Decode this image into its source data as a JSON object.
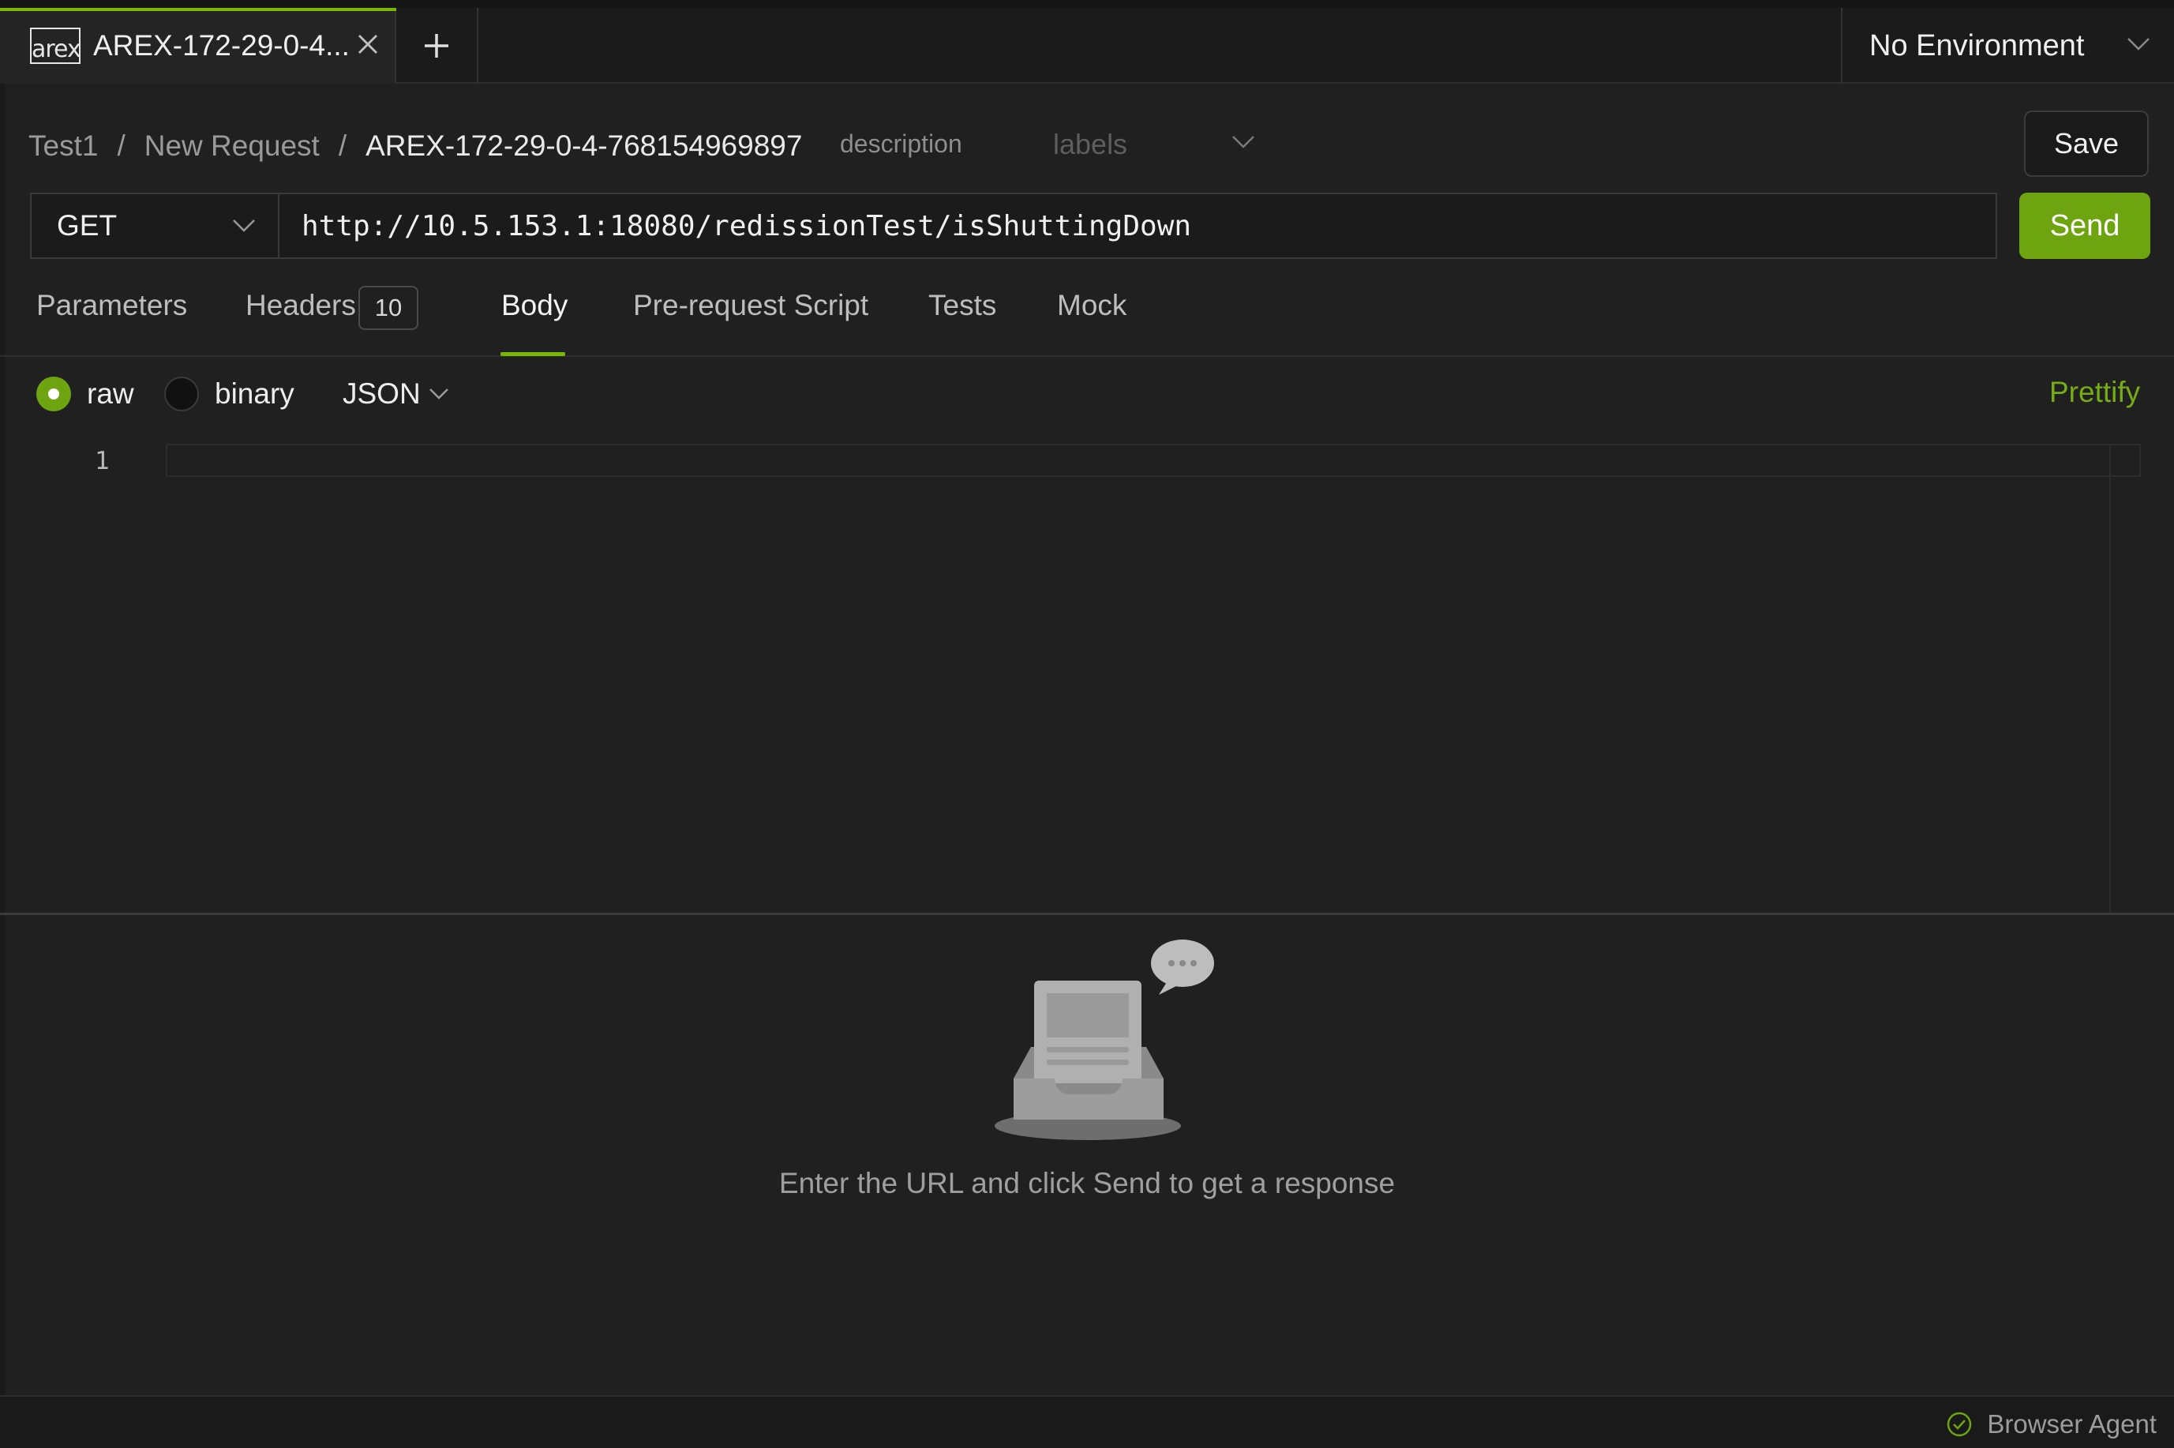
{
  "tabs": [
    {
      "logo_text": "arex",
      "title": "AREX-172-29-0-4..."
    }
  ],
  "environment": {
    "selected": "No Environment"
  },
  "breadcrumb": {
    "items": [
      "Test1",
      "New Request",
      "AREX-172-29-0-4-768154969897"
    ],
    "separator": "/"
  },
  "request_meta": {
    "description_placeholder": "description",
    "labels_placeholder": "labels"
  },
  "toolbar": {
    "save_label": "Save",
    "send_label": "Send"
  },
  "request": {
    "method": "GET",
    "url": "http://10.5.153.1:18080/redissionTest/isShuttingDown"
  },
  "request_tabs": {
    "parameters": "Parameters",
    "headers": "Headers",
    "headers_count": "10",
    "body": "Body",
    "pre_request": "Pre-request Script",
    "tests": "Tests",
    "mock": "Mock",
    "active": "Body"
  },
  "body_options": {
    "raw": "raw",
    "binary": "binary",
    "format": "JSON",
    "selected": "raw",
    "prettify": "Prettify"
  },
  "editor": {
    "line_number": "1"
  },
  "response": {
    "empty_message": "Enter the URL and click Send to get a response"
  },
  "status_bar": {
    "agent_label": "Browser Agent"
  },
  "colors": {
    "accent": "#7ab800",
    "send_bg": "#6da410",
    "background": "#202020"
  },
  "icons": [
    "close-icon",
    "plus-icon",
    "chevron-down-icon",
    "check-circle-icon",
    "inbox-empty-icon"
  ]
}
